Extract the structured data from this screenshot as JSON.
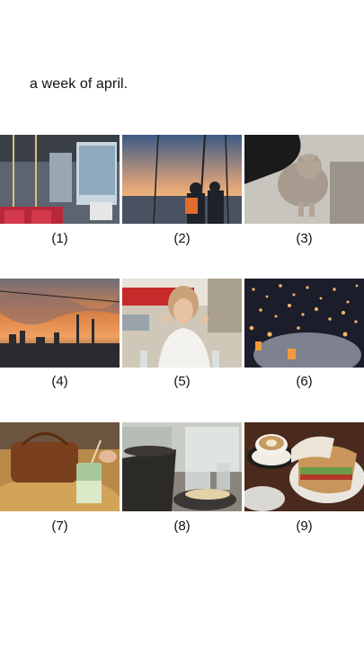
{
  "post": {
    "title": "a week of april."
  },
  "photos": [
    {
      "label": "(1)",
      "icon": "bus-interior-photo"
    },
    {
      "label": "(2)",
      "icon": "sunset-boat-photo"
    },
    {
      "label": "(3)",
      "icon": "cat-photo"
    },
    {
      "label": "(4)",
      "icon": "city-sunset-photo"
    },
    {
      "label": "(5)",
      "icon": "woman-cafe-photo"
    },
    {
      "label": "(6)",
      "icon": "lanterns-photo"
    },
    {
      "label": "(7)",
      "icon": "matcha-bag-photo"
    },
    {
      "label": "(8)",
      "icon": "restaurant-table-photo"
    },
    {
      "label": "(9)",
      "icon": "coffee-sandwich-photo"
    }
  ]
}
